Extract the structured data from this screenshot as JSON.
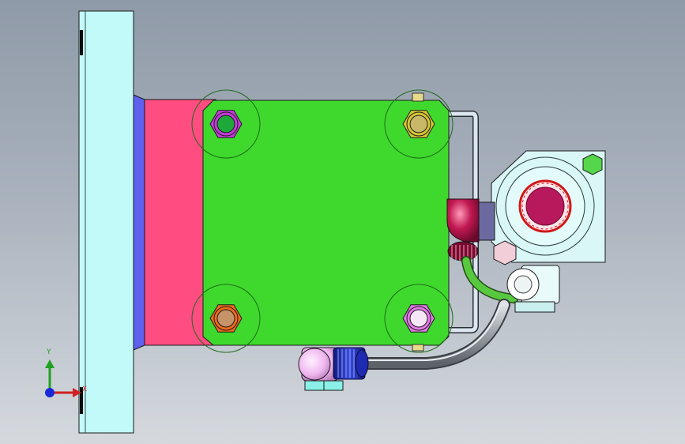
{
  "viewport": {
    "background_top": "#8f9aa8",
    "background_bottom": "#d5d9de"
  },
  "model": {
    "parts": [
      {
        "name": "mounting-plate",
        "color": "#c2fafa"
      },
      {
        "name": "adapter-block",
        "color": "#ff4d82"
      },
      {
        "name": "side-strip",
        "color": "#6060ee"
      },
      {
        "name": "valve-body",
        "color": "#3fd92d"
      },
      {
        "name": "bypass-tube",
        "color": "#d8e4ee"
      },
      {
        "name": "flange-fitting",
        "color": "#d9f7f7"
      },
      {
        "name": "elbow-fitting",
        "color": "#b8134c"
      },
      {
        "name": "green-hose",
        "color": "#58c93e"
      },
      {
        "name": "grey-pipe",
        "color": "#8a8f95"
      },
      {
        "name": "bottom-fitting",
        "color": "#f0b8f0"
      },
      {
        "name": "knurled-nut",
        "color": "#2232b8"
      }
    ],
    "bolts": [
      {
        "name": "bolt-top-left",
        "hex": "#c93ae0",
        "center": "#1fa83a"
      },
      {
        "name": "bolt-top-right",
        "hex": "#d6c832",
        "center": "#c9b868"
      },
      {
        "name": "bolt-bottom-left",
        "hex": "#f06a1a",
        "center": "#c79368"
      },
      {
        "name": "bolt-bottom-right",
        "hex": "#e47ae8",
        "center": "#f6e6f6"
      }
    ]
  },
  "triad": {
    "x_label": "X",
    "y_label": "Y",
    "x_color": "#d02020",
    "y_color": "#20a020",
    "z_color": "#1b2ad8"
  }
}
